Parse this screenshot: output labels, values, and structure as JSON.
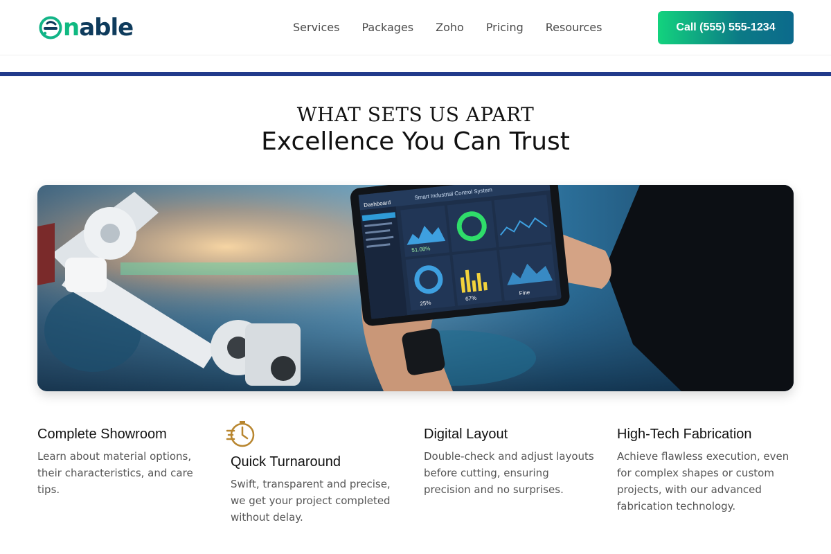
{
  "header": {
    "logo_text": "enable",
    "nav": [
      "Services",
      "Packages",
      "Zoho",
      "Pricing",
      "Resources"
    ],
    "cta_label": "Call (555) 555-1234"
  },
  "section": {
    "eyebrow": "WHAT SETS US APART",
    "title": "Excellence You Can Trust"
  },
  "hero": {
    "tablet": {
      "sidebar_title": "Dashboard",
      "header_title": "Smart Industrial Control System",
      "metrics": [
        "51.08%",
        "25%",
        "67%",
        "Fine"
      ]
    }
  },
  "features": [
    {
      "title": "Complete Showroom",
      "text": "Learn about material options, their characteristics, and care tips."
    },
    {
      "title": "Quick Turnaround",
      "text": "Swift, transparent and precise, we get your project completed without delay.",
      "icon": "fast-clock-icon"
    },
    {
      "title": "Digital Layout",
      "text": "Double-check and adjust layouts before cutting, ensuring precision and no surprises."
    },
    {
      "title": "High-Tech Fabrication",
      "text": "Achieve flawless execution, even for complex shapes or custom projects, with our advanced fabrication technology."
    }
  ],
  "colors": {
    "brand_navy": "#0e3b5c",
    "brand_green": "#10b981",
    "rule": "#213a8b",
    "icon_gold": "#b8862f"
  }
}
